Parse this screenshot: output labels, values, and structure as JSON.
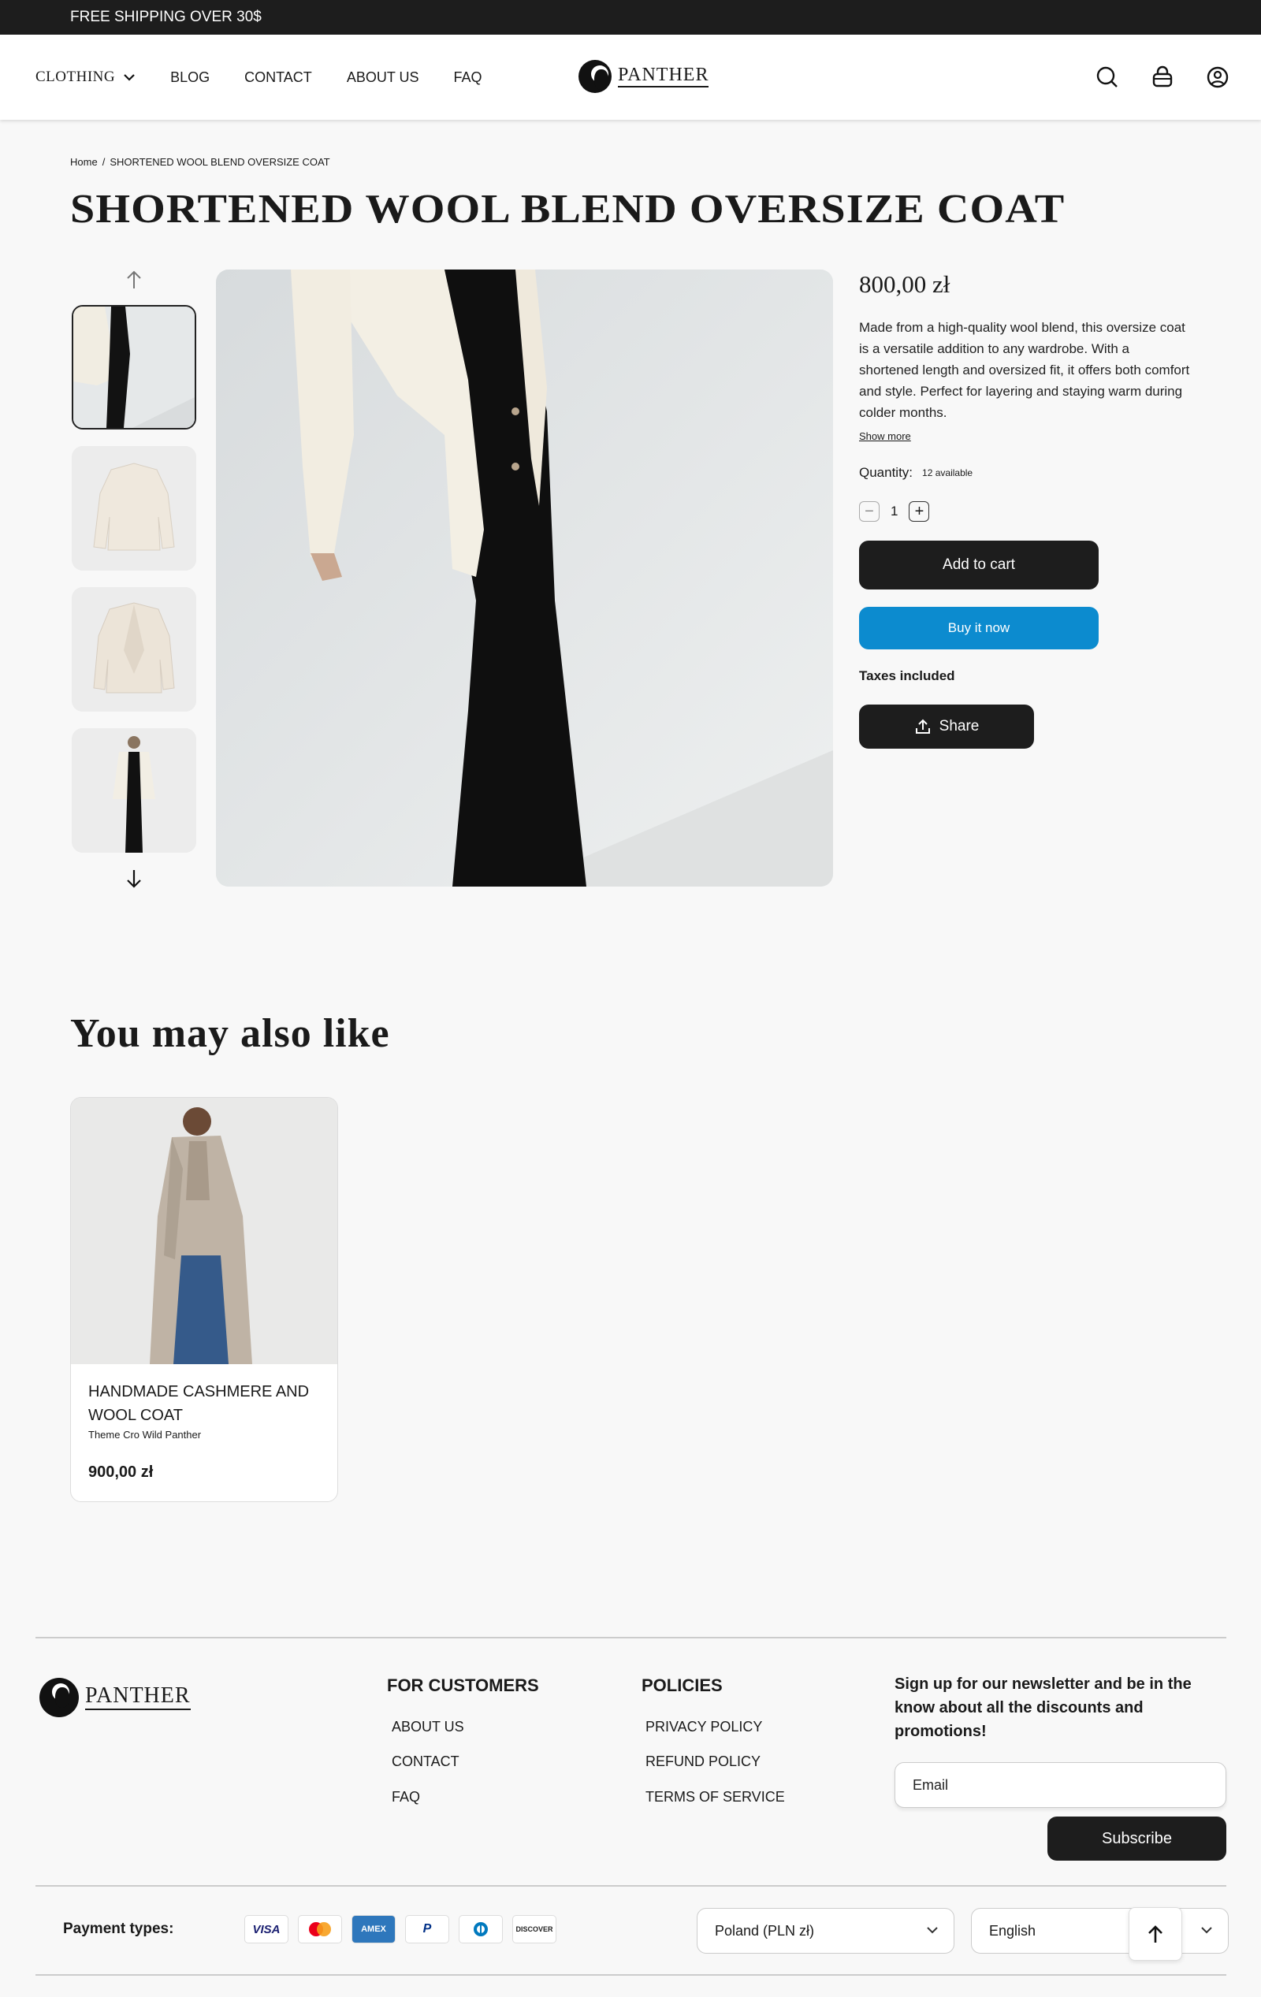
{
  "announcement": "FREE SHIPPING OVER 30$",
  "nav": {
    "items": [
      "CLOTHING",
      "BLOG",
      "CONTACT",
      "ABOUT US",
      "FAQ"
    ],
    "logo_text": "PANTHER"
  },
  "header_icons": [
    "search-icon",
    "cart-icon",
    "account-icon"
  ],
  "breadcrumb": {
    "home": "Home",
    "sep": "/",
    "current": "SHORTENED WOOL BLEND OVERSIZE COAT"
  },
  "product": {
    "title": "SHORTENED WOOL BLEND OVERSIZE COAT",
    "price": "800,00 zł",
    "description": "Made from a high-quality wool blend, this oversize coat is a versatile addition to any wardrobe. With a shortened length and oversized fit, it offers both comfort and style. Perfect for layering and staying warm during colder months.",
    "show_more": "Show more",
    "quantity_label": "Quantity:",
    "available": "12 available",
    "quantity": "1",
    "add_to_cart": "Add to cart",
    "buy_now": "Buy it now",
    "taxes": "Taxes included",
    "share": "Share"
  },
  "recommend": {
    "heading": "You may also like",
    "card": {
      "title": "HANDMADE CASHMERE AND WOOL COAT",
      "vendor": "Theme Cro Wild Panther",
      "price": "900,00 zł"
    }
  },
  "footer": {
    "logo_text": "PANTHER",
    "customers_title": "FOR CUSTOMERS",
    "customers_links": [
      "ABOUT US",
      "CONTACT",
      "FAQ"
    ],
    "policies_title": "POLICIES",
    "policies_links": [
      "PRIVACY POLICY",
      "REFUND POLICY",
      "TERMS OF SERVICE"
    ],
    "newsletter": "Sign up for our newsletter and be in the know about all the discounts and promotions!",
    "email_placeholder": "Email",
    "subscribe": "Subscribe",
    "payment_label": "Payment types:",
    "payments": [
      "VISA",
      "Mastercard",
      "AMEX",
      "PayPal",
      "Diners",
      "DISCOVER"
    ],
    "country": "Poland (PLN zł)",
    "language": "English"
  },
  "colors": {
    "dark": "#1d1d1d",
    "buy_now": "#0c8bcf",
    "background": "#f8f8f8"
  }
}
